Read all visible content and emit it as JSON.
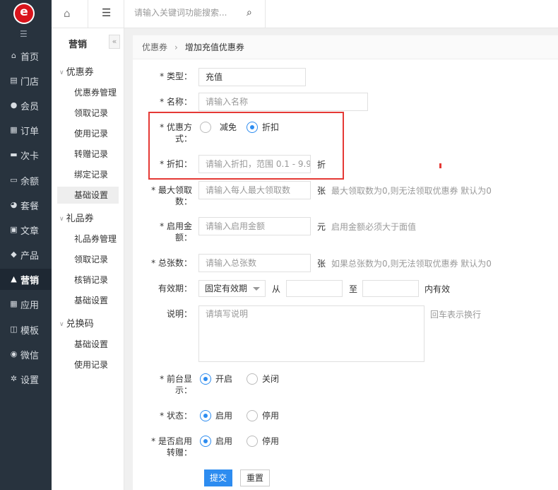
{
  "sidebar": {
    "logo_letter": "e",
    "items": [
      {
        "label": "首页",
        "icon": "home-icon",
        "glyph": "⌂"
      },
      {
        "label": "门店",
        "icon": "store-icon",
        "glyph": "▤"
      },
      {
        "label": "会员",
        "icon": "user-icon",
        "glyph": "●"
      },
      {
        "label": "订单",
        "icon": "order-icon",
        "glyph": "▦"
      },
      {
        "label": "次卡",
        "icon": "card-icon",
        "glyph": "▬"
      },
      {
        "label": "余额",
        "icon": "balance-icon",
        "glyph": "▭"
      },
      {
        "label": "套餐",
        "icon": "package-icon",
        "glyph": "◕"
      },
      {
        "label": "文章",
        "icon": "article-icon",
        "glyph": "▣"
      },
      {
        "label": "产品",
        "icon": "tag-icon",
        "glyph": "◆"
      },
      {
        "label": "营销",
        "icon": "thumbs-up-icon",
        "glyph": "▲"
      },
      {
        "label": "应用",
        "icon": "grid-icon",
        "glyph": "▦"
      },
      {
        "label": "模板",
        "icon": "template-icon",
        "glyph": "◫"
      },
      {
        "label": "微信",
        "icon": "wechat-icon",
        "glyph": "◉"
      },
      {
        "label": "设置",
        "icon": "gear-icon",
        "glyph": "✲"
      }
    ]
  },
  "subnav": {
    "title": "营销",
    "fold": "«",
    "groups": [
      {
        "label": "优惠券",
        "items": [
          "优惠券管理",
          "领取记录",
          "使用记录",
          "转赠记录",
          "绑定记录",
          "基础设置"
        ]
      },
      {
        "label": "礼品券",
        "items": [
          "礼品券管理",
          "领取记录",
          "核销记录",
          "基础设置"
        ]
      },
      {
        "label": "兑换码",
        "items": [
          "基础设置",
          "使用记录"
        ]
      }
    ]
  },
  "topbar": {
    "search_placeholder": "请输入关键词功能搜索..."
  },
  "breadcrumb": {
    "parent": "优惠券",
    "separator": "›",
    "current": "增加充值优惠券"
  },
  "form": {
    "type": {
      "label": "* 类型：",
      "value": "充值"
    },
    "name": {
      "label": "* 名称：",
      "placeholder": "请输入名称"
    },
    "mode": {
      "label_line1": "* 优惠方",
      "label_line2": "式：",
      "options": [
        "减免",
        "折扣"
      ],
      "selected": "折扣"
    },
    "discount": {
      "label": "* 折扣：",
      "placeholder": "请输入折扣，范围 0.1 - 9.9",
      "unit": "折"
    },
    "max_receive": {
      "label_line1": "* 最大领取",
      "label_line2": "数：",
      "placeholder": "请输入每人最大领取数",
      "unit": "张",
      "hint": "最大领取数为0,则无法领取优惠券 默认为0"
    },
    "min_amount": {
      "label_line1": "* 启用金",
      "label_line2": "额：",
      "placeholder": "请输入启用金额",
      "unit": "元",
      "hint": "启用金额必须大于面值"
    },
    "total": {
      "label": "* 总张数：",
      "placeholder": "请输入总张数",
      "unit": "张",
      "hint": "如果总张数为0,则无法领取优惠券 默认为0"
    },
    "validity": {
      "label": "有效期：",
      "select_value": "固定有效期",
      "from": "从",
      "to": "至",
      "suffix": "内有效"
    },
    "description": {
      "label": "说明：",
      "placeholder": "请填写说明",
      "hint": "回车表示换行"
    },
    "frontend": {
      "label_line1": "* 前台显",
      "label_line2": "示：",
      "options": [
        "开启",
        "关闭"
      ],
      "selected": "开启"
    },
    "status": {
      "label": "* 状态：",
      "options": [
        "启用",
        "停用"
      ],
      "selected": "启用"
    },
    "transfer": {
      "label_line1": "* 是否启用",
      "label_line2": "转赠：",
      "options": [
        "启用",
        "停用"
      ],
      "selected": "启用"
    },
    "submit_label": "提交",
    "reset_label": "重置"
  },
  "colors": {
    "sidebar_bg": "#28333e",
    "accent": "#2d8cf0",
    "highlight_box": "#e53935"
  }
}
